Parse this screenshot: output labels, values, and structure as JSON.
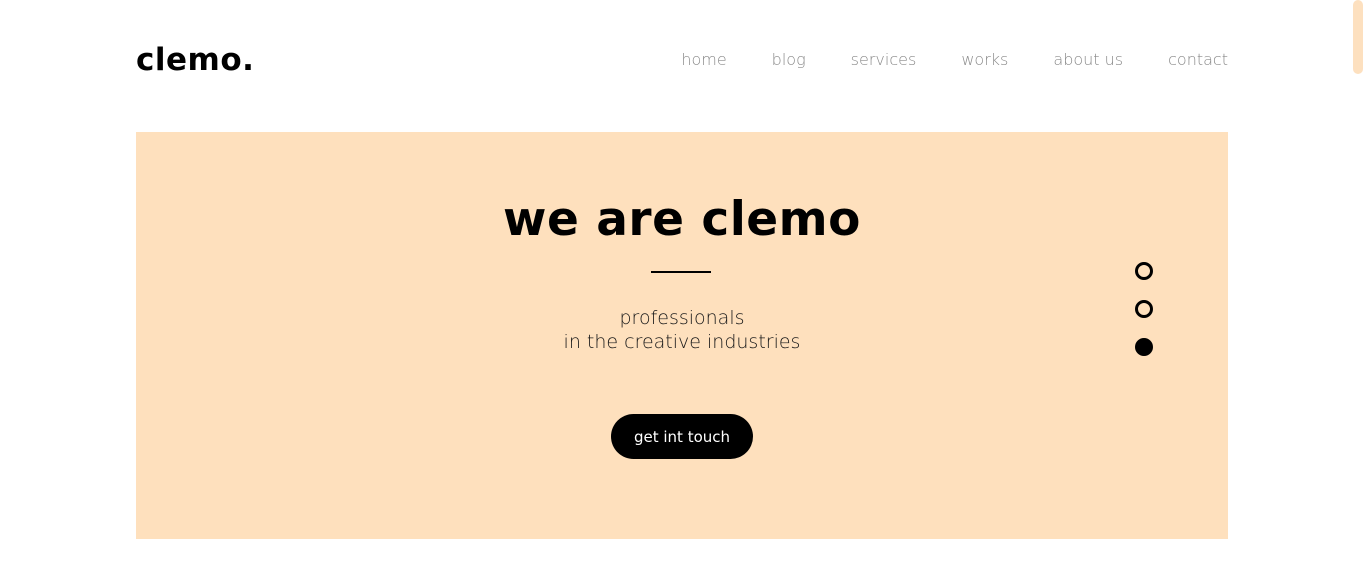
{
  "brand": {
    "logo": "clemo."
  },
  "nav": {
    "items": [
      {
        "label": "home"
      },
      {
        "label": "blog"
      },
      {
        "label": "services"
      },
      {
        "label": "works"
      },
      {
        "label": "about us"
      },
      {
        "label": "contact"
      }
    ]
  },
  "hero": {
    "title": "we are clemo",
    "subtitle_line1": "professionals",
    "subtitle_line2": "in the creative industries",
    "cta_label": "get int touch",
    "slider": {
      "count": 3,
      "active_index": 2
    }
  },
  "colors": {
    "hero_background": "#fee0bd",
    "text_primary": "#000000",
    "nav_text": "#8a8a8a",
    "cta_background": "#000000",
    "cta_text": "#ffffff"
  }
}
